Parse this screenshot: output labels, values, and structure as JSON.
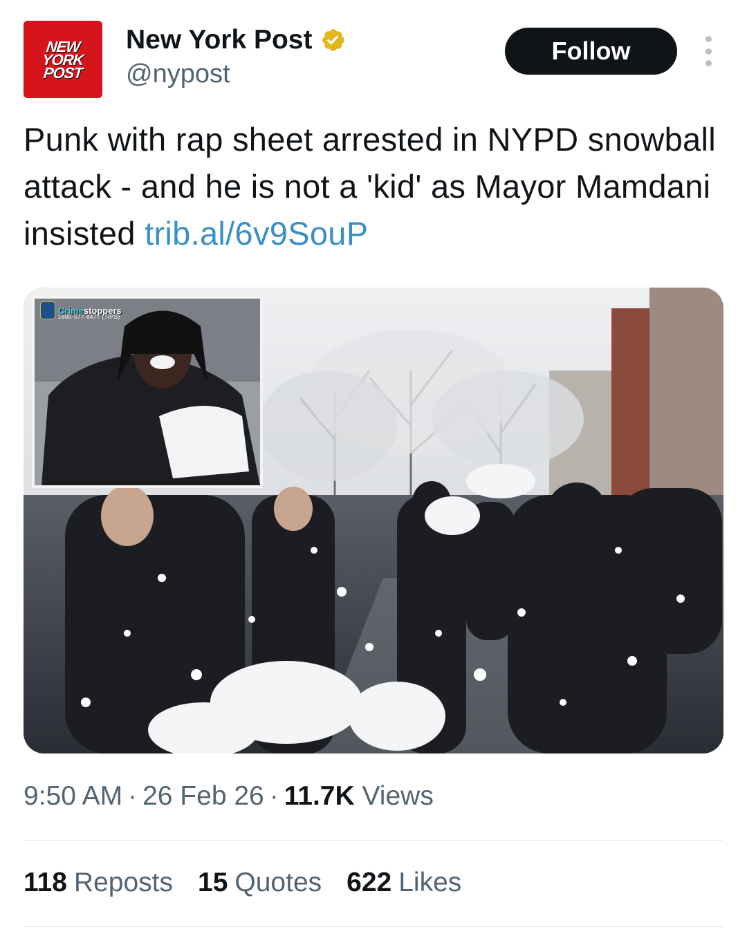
{
  "account": {
    "logo_lines": [
      "NEW",
      "YORK",
      "POST"
    ],
    "display_name": "New York Post",
    "handle": "@nypost",
    "verified_color": "#e2b719"
  },
  "header": {
    "follow_label": "Follow",
    "more_icon": "more-vertical-icon"
  },
  "tweet": {
    "text": "Punk with rap sheet arrested in NYPD snowball attack - and he is not a 'kid' as Mayor Mamdani insisted ",
    "link": "trib.al/6v9SouP",
    "link_color": "#3a8fc4"
  },
  "media": {
    "inset_brand_prefix": "Crime",
    "inset_brand": "stoppers",
    "inset_phone": "1800-577-8477 (TIPS)"
  },
  "meta": {
    "time": "9:50 AM",
    "date": "26 Feb 26",
    "views_count": "11.7K",
    "views_label": "Views",
    "separator": "·"
  },
  "stats": {
    "reposts_count": "118",
    "reposts_label": "Reposts",
    "quotes_count": "15",
    "quotes_label": "Quotes",
    "likes_count": "622",
    "likes_label": "Likes"
  }
}
